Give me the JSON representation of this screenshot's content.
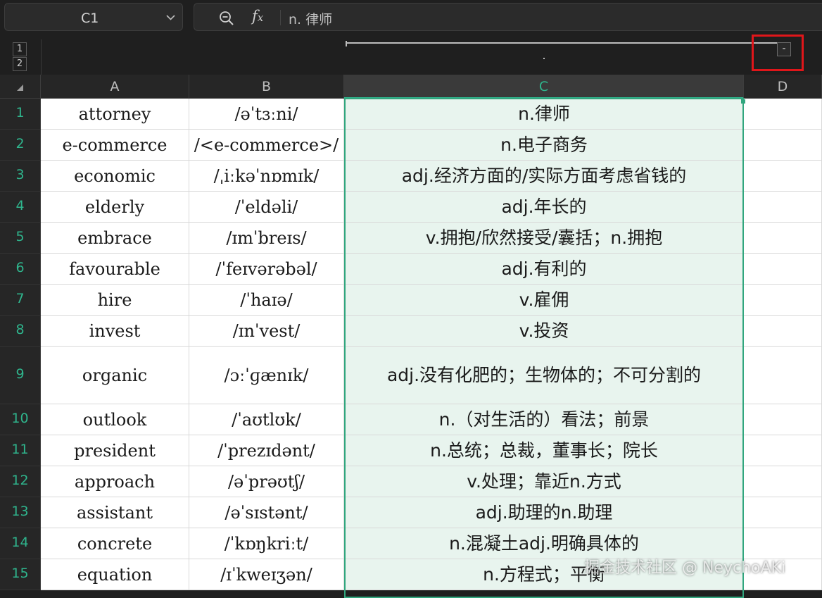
{
  "formula_bar": {
    "cell_ref": "C1",
    "formula": "n. 律师"
  },
  "outline": {
    "levels": [
      "1",
      "2"
    ],
    "collapse_symbol": "-"
  },
  "columns": [
    "A",
    "B",
    "C",
    "D"
  ],
  "selected_column": "C",
  "rows": [
    {
      "num": "1",
      "a": "attorney",
      "b": "/əˈtɜːni/",
      "c": "n.律师"
    },
    {
      "num": "2",
      "a": "e-commerce",
      "b": "/<e-commerce>/",
      "c": "n.电子商务"
    },
    {
      "num": "3",
      "a": "economic",
      "b": "/ˌiːkəˈnɒmɪk/",
      "c": "adj.经济方面的/实际方面考虑省钱的"
    },
    {
      "num": "4",
      "a": "elderly",
      "b": "/ˈeldəli/",
      "c": "adj.年长的"
    },
    {
      "num": "5",
      "a": "embrace",
      "b": "/ɪmˈbreɪs/",
      "c": "v.拥抱/欣然接受/囊括；n.拥抱"
    },
    {
      "num": "6",
      "a": "favourable",
      "b": "/ˈfeɪvərəbəl/",
      "c": "adj.有利的"
    },
    {
      "num": "7",
      "a": "hire",
      "b": "/ˈhaɪə/",
      "c": "v.雇佣"
    },
    {
      "num": "8",
      "a": "invest",
      "b": "/ɪnˈvest/",
      "c": "v.投资"
    },
    {
      "num": "9",
      "a": "organic",
      "b": "/ɔːˈɡænɪk/",
      "c": "adj.没有化肥的；生物体的；不可分割的"
    },
    {
      "num": "10",
      "a": "outlook",
      "b": "/ˈaʊtlʊk/",
      "c": "n.（对生活的）看法；前景"
    },
    {
      "num": "11",
      "a": "president",
      "b": "/ˈprezɪdənt/",
      "c": "n.总统；总裁，董事长；院长"
    },
    {
      "num": "12",
      "a": "approach",
      "b": "/əˈprəʊtʃ/",
      "c": "v.处理；靠近n.方式"
    },
    {
      "num": "13",
      "a": "assistant",
      "b": "/əˈsɪstənt/",
      "c": "adj.助理的n.助理"
    },
    {
      "num": "14",
      "a": "concrete",
      "b": "/ˈkɒŋkriːt/",
      "c": "n.混凝土adj.明确具体的"
    },
    {
      "num": "15",
      "a": "equation",
      "b": "/ɪˈkweɪʒən/",
      "c": "n.方程式；平衡"
    }
  ],
  "watermark": "掘金技术社区 @ NeychoAKi",
  "colors": {
    "accent": "#2fb58d",
    "highlight_box": "#e0161a",
    "selection_fill": "#e8f4ee"
  }
}
